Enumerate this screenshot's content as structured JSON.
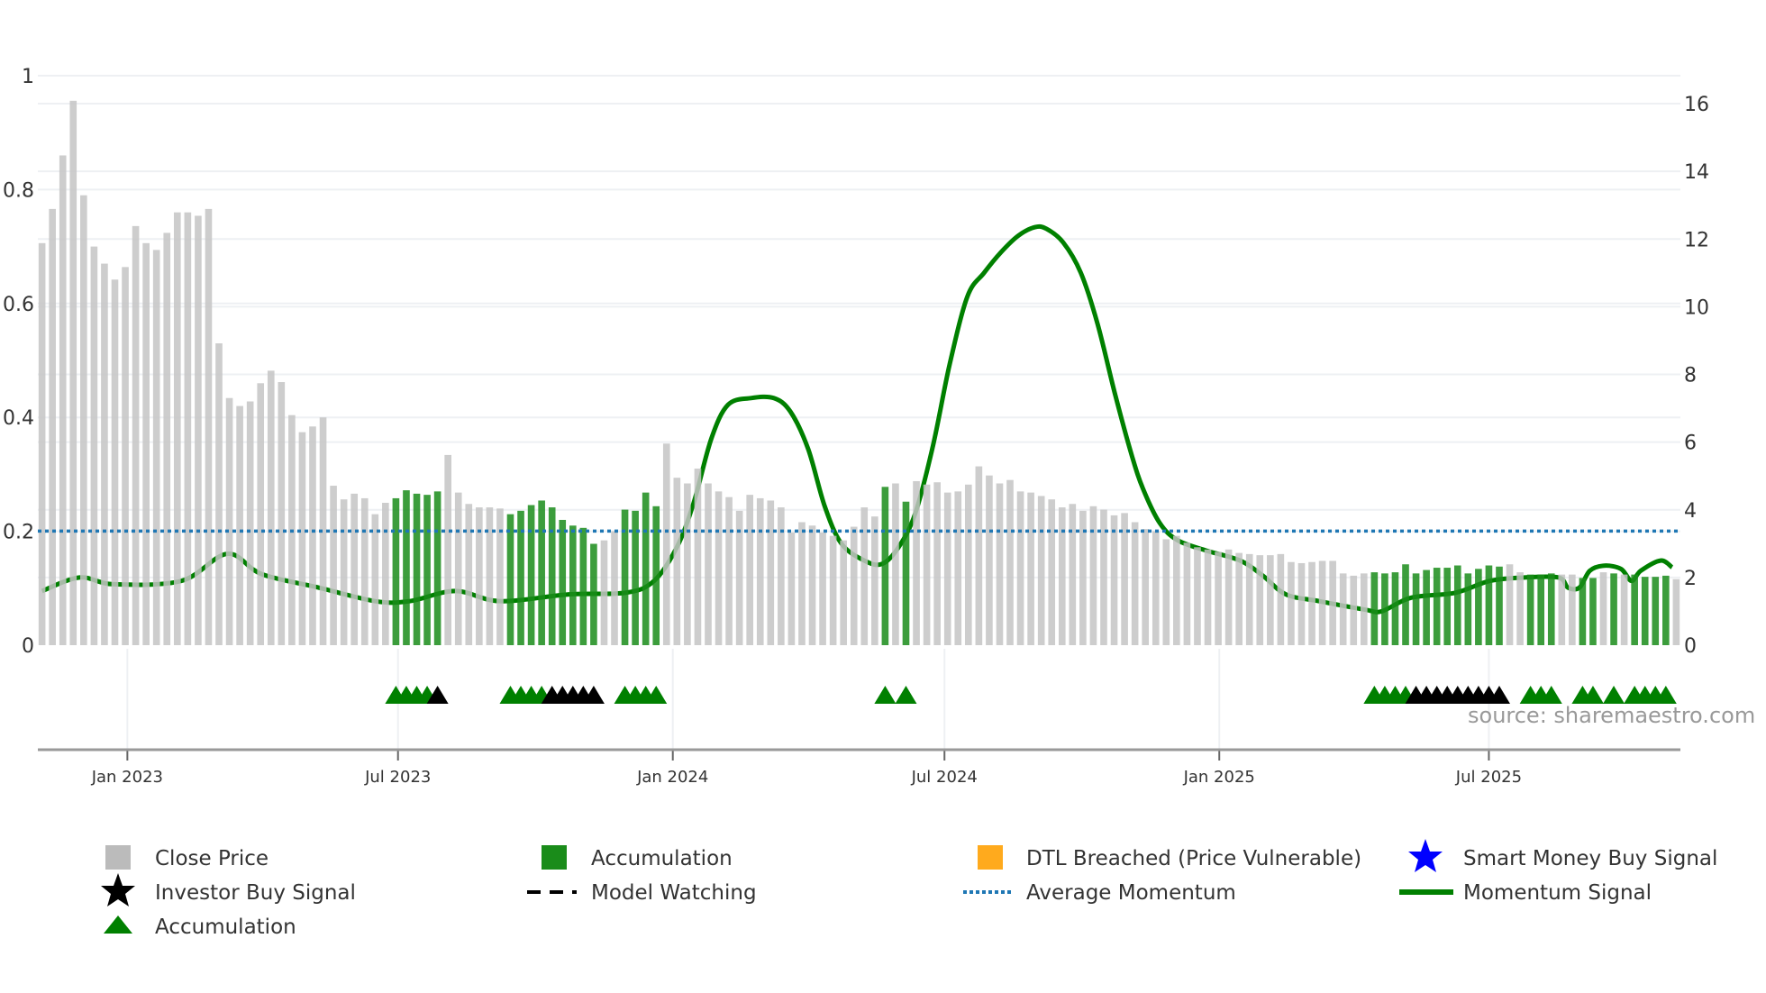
{
  "chart_data": {
    "type": "bar",
    "title": "",
    "source": "source: sharemaestro.com",
    "x_unit": "week index",
    "x_ticks": [
      {
        "pos": 8.2,
        "label": "Jan 2023"
      },
      {
        "pos": 34.2,
        "label": "Jul 2023"
      },
      {
        "pos": 60.6,
        "label": "Jan 2024"
      },
      {
        "pos": 86.7,
        "label": "Jul 2024"
      },
      {
        "pos": 113.1,
        "label": "Jan 2025"
      },
      {
        "pos": 139.0,
        "label": "Jul 2025"
      }
    ],
    "xlim": [
      -0.4,
      157.4
    ],
    "left_axis": {
      "ylim": [
        0,
        1
      ],
      "ticks": [
        "0",
        "0.2",
        "0.4",
        "0.6",
        "0.8",
        "1"
      ],
      "tick_values": [
        0,
        0.2,
        0.4,
        0.6,
        0.8,
        1
      ]
    },
    "right_axis": {
      "ylim": [
        0,
        16
      ],
      "ticks": [
        "0",
        "2",
        "4",
        "6",
        "8",
        "10",
        "12",
        "14",
        "16"
      ],
      "tick_values": [
        0,
        2,
        4,
        6,
        8,
        10,
        12,
        14,
        16
      ]
    },
    "close_price": [
      0.706,
      0.766,
      0.86,
      0.956,
      0.79,
      0.7,
      0.67,
      0.642,
      0.664,
      0.736,
      0.706,
      0.694,
      0.724,
      0.76,
      0.76,
      0.754,
      0.766,
      0.53,
      0.434,
      0.42,
      0.428,
      0.46,
      0.482,
      0.462,
      0.404,
      0.374,
      0.384,
      0.4,
      0.28,
      0.256,
      0.266,
      0.258,
      0.23,
      0.25,
      0.258,
      0.272,
      0.266,
      0.264,
      0.27,
      0.334,
      0.268,
      0.248,
      0.242,
      0.242,
      0.24,
      0.23,
      0.236,
      0.246,
      0.254,
      0.242,
      0.22,
      0.21,
      0.206,
      0.178,
      0.184,
      0.2,
      0.238,
      0.236,
      0.268,
      0.244,
      0.354,
      0.294,
      0.284,
      0.31,
      0.284,
      0.27,
      0.26,
      0.236,
      0.264,
      0.258,
      0.254,
      0.242,
      0.198,
      0.216,
      0.21,
      0.198,
      0.192,
      0.184,
      0.208,
      0.242,
      0.226,
      0.278,
      0.284,
      0.252,
      0.288,
      0.282,
      0.286,
      0.268,
      0.27,
      0.282,
      0.314,
      0.298,
      0.284,
      0.29,
      0.27,
      0.268,
      0.262,
      0.256,
      0.242,
      0.248,
      0.236,
      0.244,
      0.238,
      0.228,
      0.232,
      0.216,
      0.204,
      0.2,
      0.186,
      0.192,
      0.18,
      0.172,
      0.168,
      0.164,
      0.168,
      0.162,
      0.16,
      0.158,
      0.158,
      0.16,
      0.146,
      0.144,
      0.146,
      0.148,
      0.148,
      0.126,
      0.122,
      0.126,
      0.128,
      0.126,
      0.128,
      0.142,
      0.126,
      0.132,
      0.136,
      0.136,
      0.14,
      0.126,
      0.134,
      0.14,
      0.138,
      0.142,
      0.128,
      0.124,
      0.124,
      0.126,
      0.124,
      0.124,
      0.118,
      0.118,
      0.128,
      0.126,
      0.124,
      0.124,
      0.12,
      0.12,
      0.122,
      0.116
    ],
    "accumulation_indices": [
      34,
      35,
      36,
      37,
      38,
      45,
      46,
      47,
      48,
      49,
      50,
      51,
      52,
      53,
      56,
      57,
      58,
      59,
      81,
      83,
      128,
      129,
      130,
      131,
      132,
      133,
      134,
      135,
      136,
      137,
      138,
      139,
      140,
      143,
      144,
      145,
      148,
      149,
      151,
      153,
      154,
      155,
      156
    ],
    "accumulation_markers": [
      34,
      35,
      36,
      37,
      45,
      46,
      47,
      48,
      56,
      57,
      58,
      59,
      81,
      83,
      128,
      129,
      130,
      131,
      143,
      144,
      145,
      148,
      149,
      151,
      153,
      154,
      155,
      156
    ],
    "investor_buy_markers": [
      38,
      49,
      50,
      51,
      52,
      53,
      132,
      133,
      134,
      135,
      136,
      137,
      138,
      139,
      140
    ],
    "momentum_signal": [
      [
        0,
        1.6
      ],
      [
        3.6,
        2.0
      ],
      [
        6.9,
        1.8
      ],
      [
        13.4,
        1.9
      ],
      [
        17.8,
        2.7
      ],
      [
        21.1,
        2.1
      ],
      [
        26.6,
        1.7
      ],
      [
        32.0,
        1.3
      ],
      [
        35.3,
        1.3
      ],
      [
        39.7,
        1.6
      ],
      [
        44.0,
        1.3
      ],
      [
        50.6,
        1.5
      ],
      [
        56.1,
        1.55
      ],
      [
        58.8,
        1.9
      ],
      [
        61.0,
        2.9
      ],
      [
        62.6,
        4.2
      ],
      [
        64.3,
        6.1
      ],
      [
        65.9,
        7.1
      ],
      [
        68.1,
        7.3
      ],
      [
        70.3,
        7.3
      ],
      [
        71.9,
        6.9
      ],
      [
        73.6,
        5.8
      ],
      [
        75.2,
        4.1
      ],
      [
        76.8,
        3.0
      ],
      [
        79.0,
        2.5
      ],
      [
        80.7,
        2.4
      ],
      [
        82.3,
        2.9
      ],
      [
        83.9,
        3.9
      ],
      [
        85.6,
        5.9
      ],
      [
        87.2,
        8.3
      ],
      [
        88.9,
        10.3
      ],
      [
        90.5,
        11.0
      ],
      [
        92.1,
        11.6
      ],
      [
        93.8,
        12.1
      ],
      [
        95.4,
        12.35
      ],
      [
        96.5,
        12.3
      ],
      [
        98.1,
        11.9
      ],
      [
        99.8,
        11.0
      ],
      [
        101.4,
        9.5
      ],
      [
        103.1,
        7.4
      ],
      [
        104.7,
        5.6
      ],
      [
        105.8,
        4.6
      ],
      [
        107.4,
        3.6
      ],
      [
        109.1,
        3.1
      ],
      [
        111.8,
        2.8
      ],
      [
        115.1,
        2.5
      ],
      [
        117.3,
        2.05
      ],
      [
        119.5,
        1.5
      ],
      [
        122.7,
        1.3
      ],
      [
        127.1,
        1.05
      ],
      [
        128.7,
        1.0
      ],
      [
        131.5,
        1.4
      ],
      [
        135.8,
        1.55
      ],
      [
        139.1,
        1.9
      ],
      [
        142.4,
        2.0
      ],
      [
        145.7,
        2.0
      ],
      [
        146.6,
        1.7
      ],
      [
        147.7,
        1.7
      ],
      [
        148.7,
        2.2
      ],
      [
        150.1,
        2.35
      ],
      [
        151.7,
        2.25
      ],
      [
        152.7,
        1.9
      ],
      [
        153.6,
        2.2
      ],
      [
        155.5,
        2.5
      ],
      [
        156.6,
        2.3
      ]
    ],
    "average_momentum": 3.37,
    "colors": {
      "close_price": "#c4c4c4",
      "accumulation_bar": "#1a8c1a",
      "momentum": "#008000",
      "average_momentum": "#1f77b4",
      "dtl": "#ffaa1d",
      "smart_money": "#0000ff",
      "investor": "#000000",
      "triangle": "#008000"
    },
    "legend": {
      "placement": "bottom",
      "items": [
        {
          "label": "Close Price",
          "icon": "gray-square"
        },
        {
          "label": "Accumulation",
          "icon": "green-square"
        },
        {
          "label": "DTL Breached (Price Vulnerable)",
          "icon": "orange-square"
        },
        {
          "label": "Smart Money Buy Signal",
          "icon": "blue-star"
        },
        {
          "label": "Investor Buy Signal",
          "icon": "black-star"
        },
        {
          "label": "Model Watching",
          "icon": "black-dash"
        },
        {
          "label": "Average Momentum",
          "icon": "blue-dots"
        },
        {
          "label": "Momentum Signal",
          "icon": "green-line"
        },
        {
          "label": "Accumulation",
          "icon": "green-triangle"
        }
      ]
    }
  }
}
